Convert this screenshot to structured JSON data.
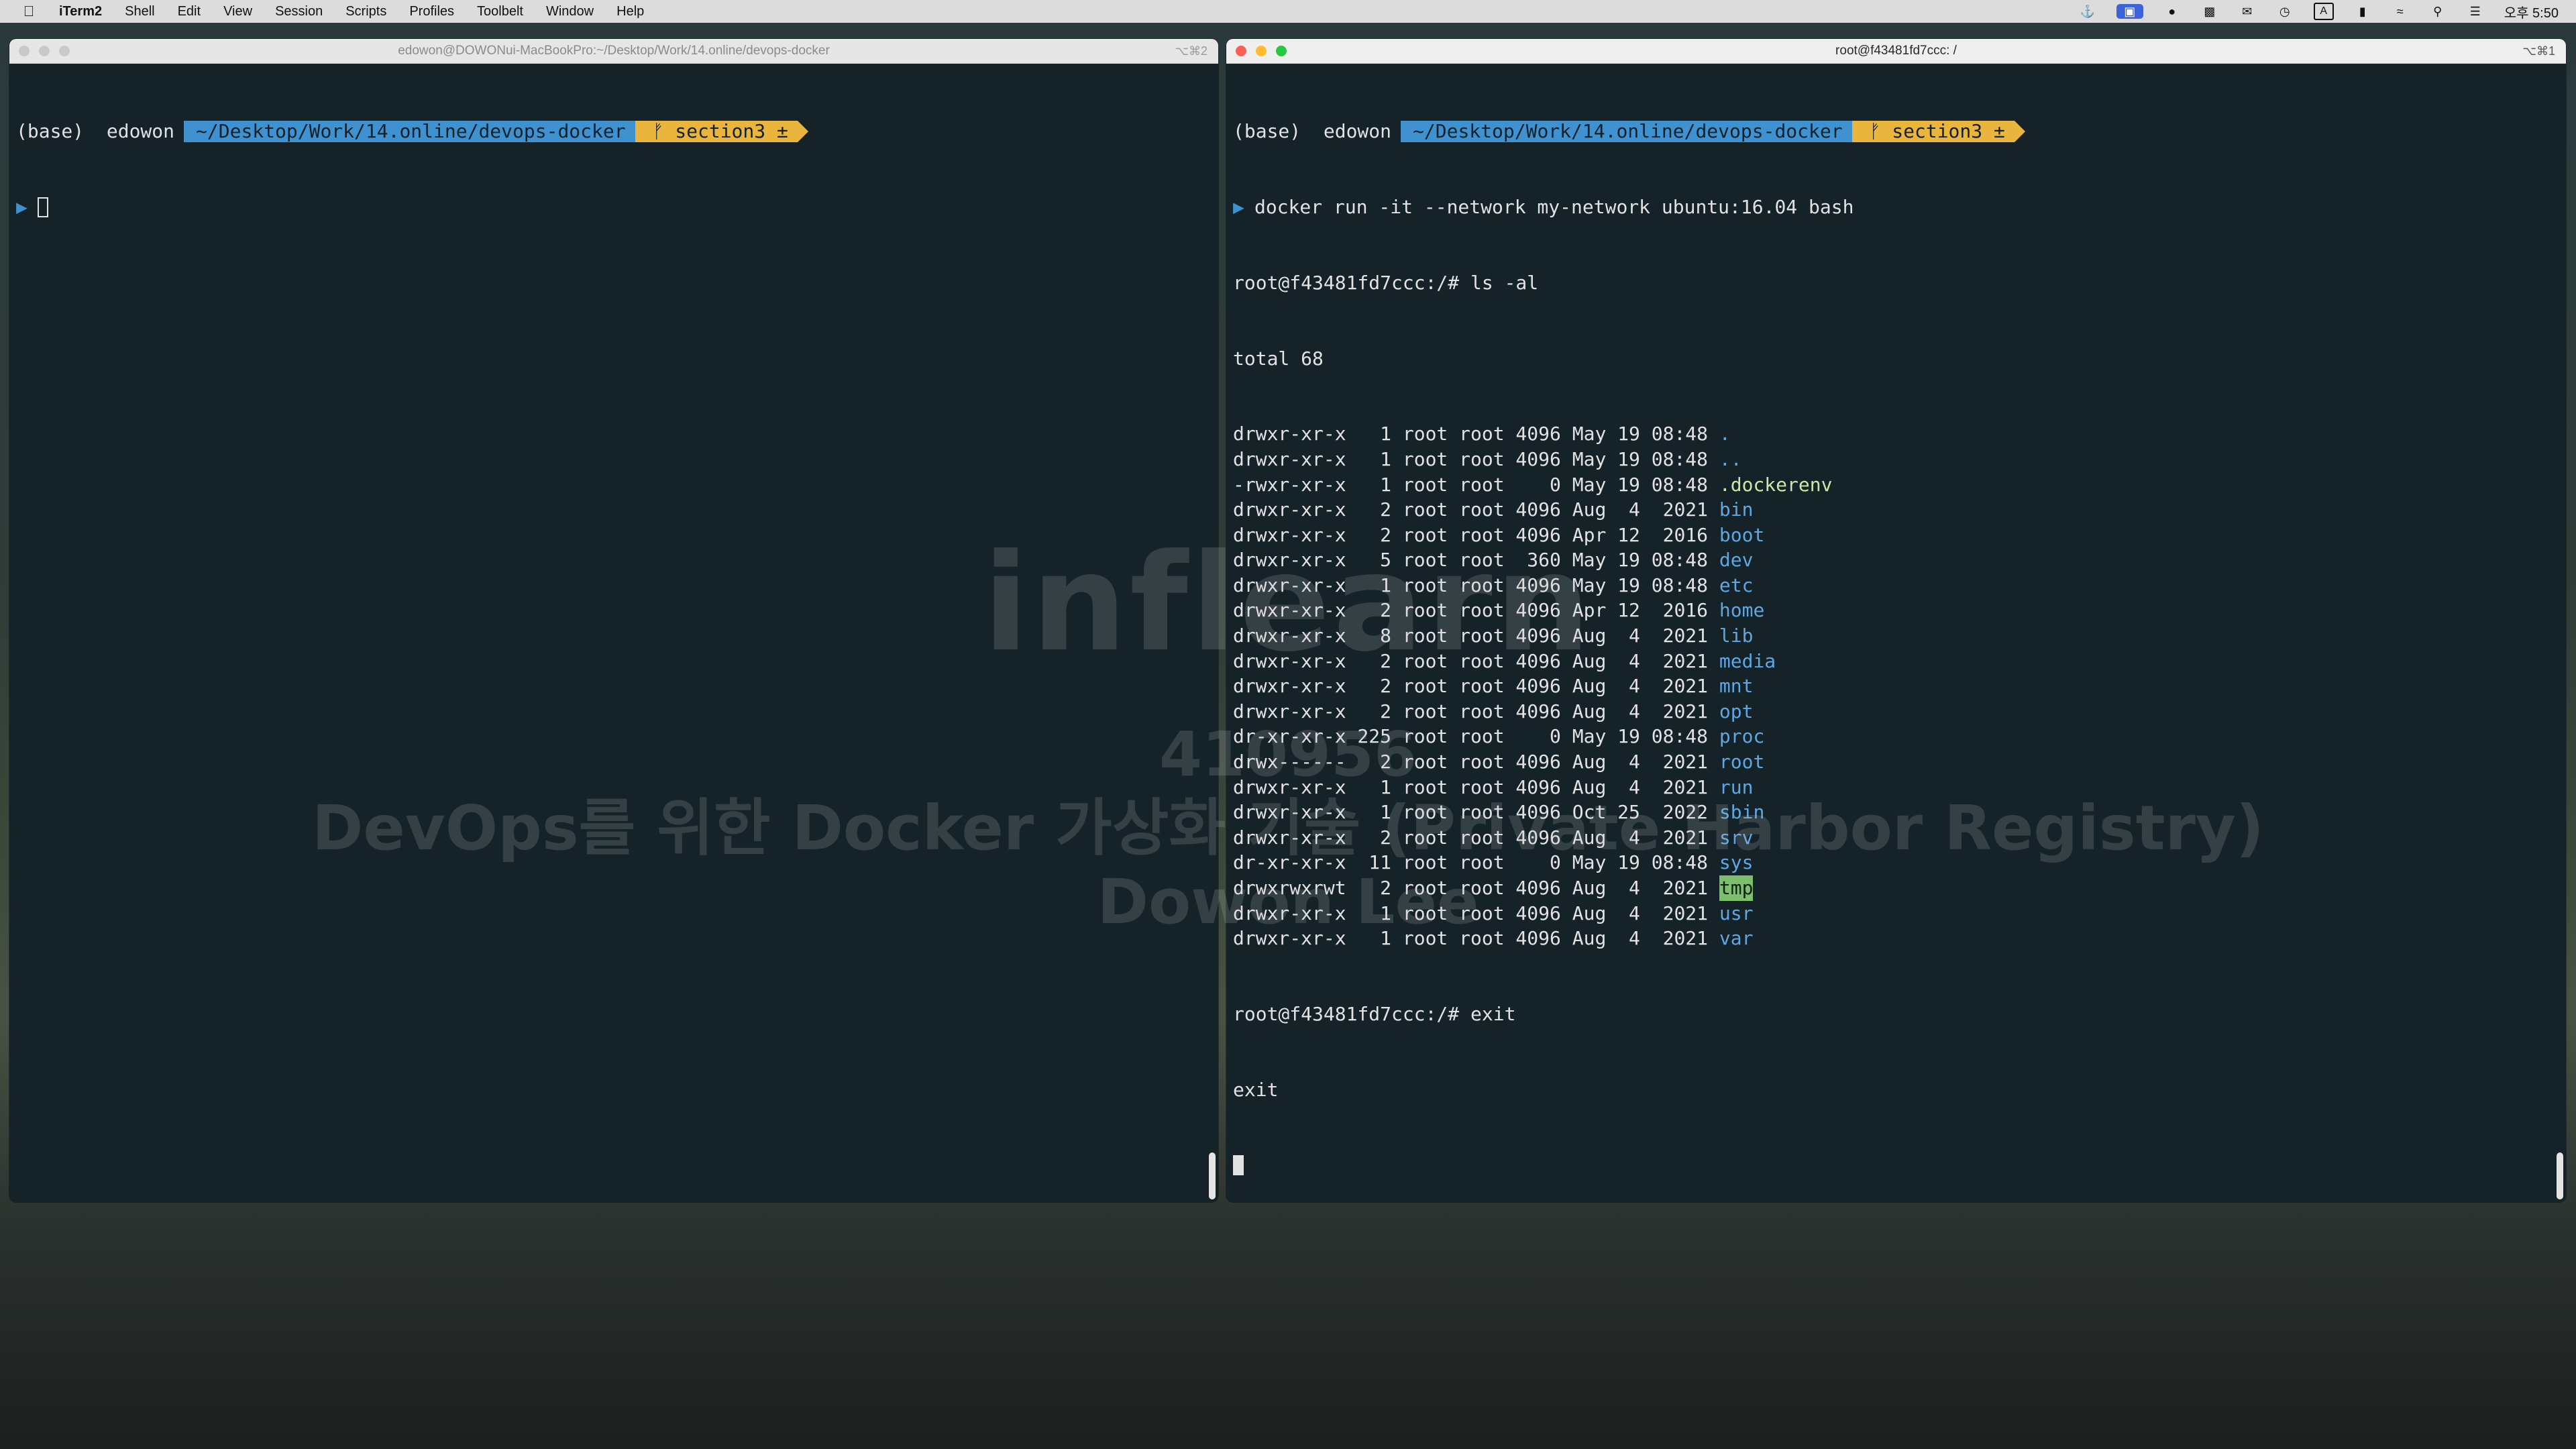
{
  "menubar": {
    "app_name": "iTerm2",
    "items": [
      "Shell",
      "Edit",
      "View",
      "Session",
      "Scripts",
      "Profiles",
      "Toolbelt",
      "Window",
      "Help"
    ],
    "status_icons": [
      "docker-icon",
      "screen-share-icon",
      "chat-icon",
      "camera-icon",
      "messenger-icon",
      "time-machine-icon",
      "input-a-icon",
      "battery-icon",
      "wifi-icon",
      "search-icon",
      "control-center-icon"
    ],
    "input_label": "A",
    "clock": "오후 5:50"
  },
  "left_window": {
    "title": "edowon@DOWONui-MacBookPro:~/Desktop/Work/14.online/devops-docker",
    "shortcut": "⌥⌘2",
    "prompt": {
      "base": "(base)  edowon",
      "path": "~/Desktop/Work/14.online/devops-docker",
      "git": "ᚠ section3 ±"
    }
  },
  "right_window": {
    "title": "root@f43481fd7ccc: /",
    "shortcut": "⌥⌘1",
    "prompt": {
      "base": "(base)  edowon",
      "path": "~/Desktop/Work/14.online/devops-docker",
      "git": "ᚠ section3 ±"
    },
    "command": "docker run -it --network my-network ubuntu:16.04 bash",
    "ls_command": "root@f43481fd7ccc:/# ls -al",
    "total": "total 68",
    "listing": [
      {
        "meta": "drwxr-xr-x   1 root root 4096 May 19 08:48 ",
        "name": ".",
        "kind": "dir"
      },
      {
        "meta": "drwxr-xr-x   1 root root 4096 May 19 08:48 ",
        "name": "..",
        "kind": "dir"
      },
      {
        "meta": "-rwxr-xr-x   1 root root    0 May 19 08:48 ",
        "name": ".dockerenv",
        "kind": "file"
      },
      {
        "meta": "drwxr-xr-x   2 root root 4096 Aug  4  2021 ",
        "name": "bin",
        "kind": "dir"
      },
      {
        "meta": "drwxr-xr-x   2 root root 4096 Apr 12  2016 ",
        "name": "boot",
        "kind": "dir"
      },
      {
        "meta": "drwxr-xr-x   5 root root  360 May 19 08:48 ",
        "name": "dev",
        "kind": "dir"
      },
      {
        "meta": "drwxr-xr-x   1 root root 4096 May 19 08:48 ",
        "name": "etc",
        "kind": "dir"
      },
      {
        "meta": "drwxr-xr-x   2 root root 4096 Apr 12  2016 ",
        "name": "home",
        "kind": "dir"
      },
      {
        "meta": "drwxr-xr-x   8 root root 4096 Aug  4  2021 ",
        "name": "lib",
        "kind": "dir"
      },
      {
        "meta": "drwxr-xr-x   2 root root 4096 Aug  4  2021 ",
        "name": "media",
        "kind": "dir"
      },
      {
        "meta": "drwxr-xr-x   2 root root 4096 Aug  4  2021 ",
        "name": "mnt",
        "kind": "dir"
      },
      {
        "meta": "drwxr-xr-x   2 root root 4096 Aug  4  2021 ",
        "name": "opt",
        "kind": "dir"
      },
      {
        "meta": "dr-xr-xr-x 225 root root    0 May 19 08:48 ",
        "name": "proc",
        "kind": "dir"
      },
      {
        "meta": "drwx------   2 root root 4096 Aug  4  2021 ",
        "name": "root",
        "kind": "dir"
      },
      {
        "meta": "drwxr-xr-x   1 root root 4096 Aug  4  2021 ",
        "name": "run",
        "kind": "dir"
      },
      {
        "meta": "drwxr-xr-x   1 root root 4096 Oct 25  2022 ",
        "name": "sbin",
        "kind": "dir"
      },
      {
        "meta": "drwxr-xr-x   2 root root 4096 Aug  4  2021 ",
        "name": "srv",
        "kind": "dir"
      },
      {
        "meta": "dr-xr-xr-x  11 root root    0 May 19 08:48 ",
        "name": "sys",
        "kind": "dir"
      },
      {
        "meta": "drwxrwxrwt   2 root root 4096 Aug  4  2021 ",
        "name": "tmp",
        "kind": "sticky"
      },
      {
        "meta": "drwxr-xr-x   1 root root 4096 Aug  4  2021 ",
        "name": "usr",
        "kind": "dir"
      },
      {
        "meta": "drwxr-xr-x   1 root root 4096 Aug  4  2021 ",
        "name": "var",
        "kind": "dir"
      }
    ],
    "exit_command": "root@f43481fd7ccc:/# exit",
    "exit_output": "exit"
  },
  "watermark": {
    "logo": "inflearn",
    "id": "410956",
    "course": "DevOps를 위한 Docker 가상화 기술 (Private Harbor Registry)",
    "author": "Dowon Lee"
  }
}
